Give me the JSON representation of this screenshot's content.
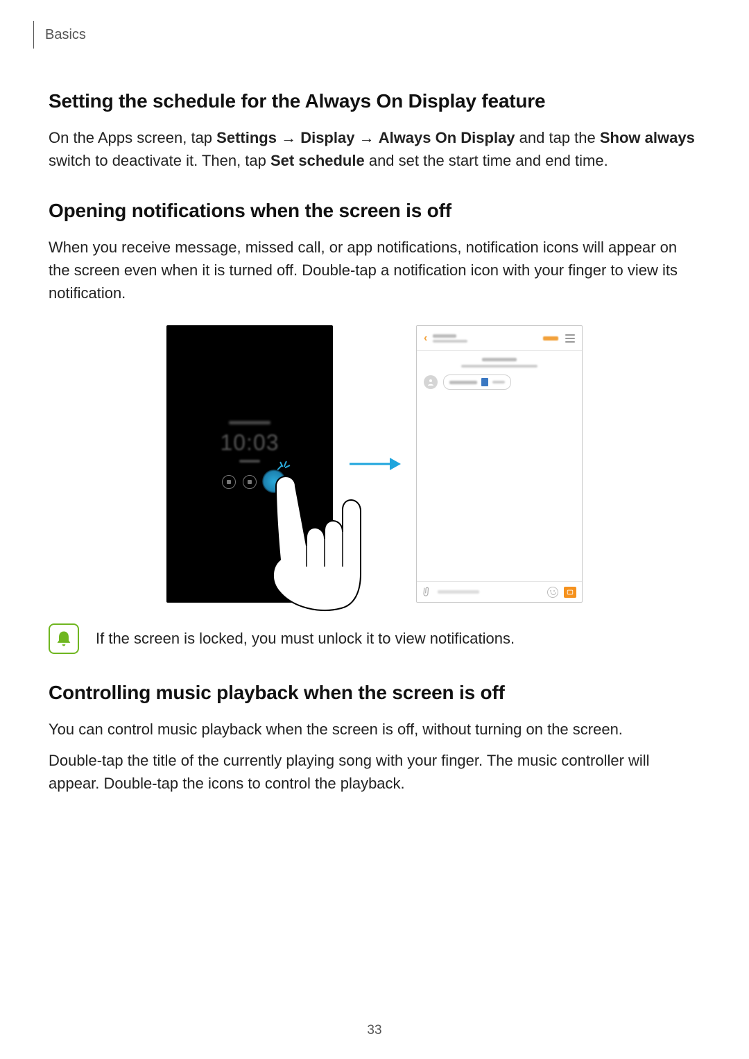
{
  "breadcrumb": "Basics",
  "section1": {
    "title": "Setting the schedule for the Always On Display feature",
    "p1_a": "On the Apps screen, tap ",
    "p1_b": "Settings",
    "p1_c": " → ",
    "p1_d": "Display",
    "p1_e": " → ",
    "p1_f": "Always On Display",
    "p1_g": " and tap the ",
    "p1_h": "Show always",
    "p1_i": " switch to deactivate it. Then, tap ",
    "p1_j": "Set schedule",
    "p1_k": " and set the start time and end time."
  },
  "section2": {
    "title": "Opening notifications when the screen is off",
    "p1": "When you receive message, missed call, or app notifications, notification icons will appear on the screen even when it is turned off. Double-tap a notification icon with your finger to view its notification."
  },
  "figure": {
    "aod_time": "10:03"
  },
  "note": {
    "text": "If the screen is locked, you must unlock it to view notifications."
  },
  "section3": {
    "title": "Controlling music playback when the screen is off",
    "p1": "You can control music playback when the screen is off, without turning on the screen.",
    "p2": "Double-tap the title of the currently playing song with your finger. The music controller will appear. Double-tap the icons to control the playback."
  },
  "page_number": "33"
}
